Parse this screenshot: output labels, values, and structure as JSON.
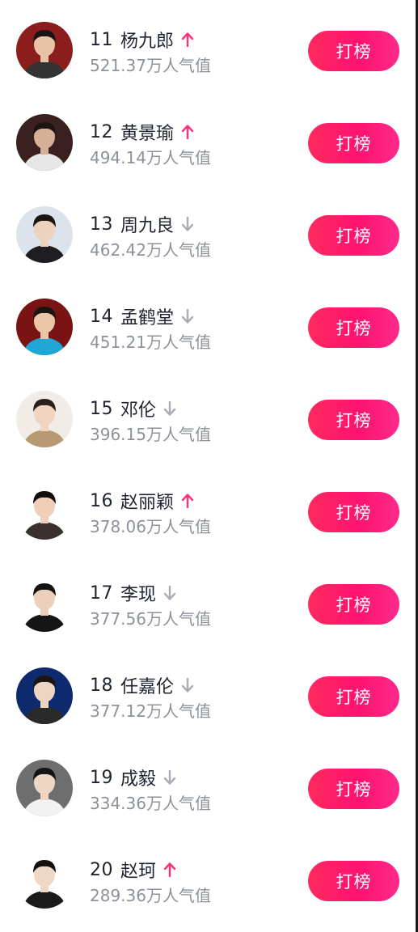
{
  "ranking": {
    "button_label": "打榜",
    "colors": {
      "up_arrow": "#ff2f7d",
      "down_arrow": "#a9acb6",
      "button_start": "#ff2a5f",
      "button_end": "#ff2a8a"
    },
    "entries": [
      {
        "rank": "11",
        "name": "杨九郎",
        "trend": "up",
        "score": "521.37万人气值",
        "avatar_bg": "#8c1d1d",
        "skin": "#e8c3a6",
        "hair": "#1a1412",
        "shirt": "#333333"
      },
      {
        "rank": "12",
        "name": "黄景瑜",
        "trend": "up",
        "score": "494.14万人气值",
        "avatar_bg": "#3a2020",
        "skin": "#d6b096",
        "hair": "#1a1412",
        "shirt": "#e6e6e6"
      },
      {
        "rank": "13",
        "name": "周九良",
        "trend": "down",
        "score": "462.42万人气值",
        "avatar_bg": "#dde3ec",
        "skin": "#edd2bd",
        "hair": "#1a1412",
        "shirt": "#1d1d22"
      },
      {
        "rank": "14",
        "name": "孟鹤堂",
        "trend": "down",
        "score": "451.21万人气值",
        "avatar_bg": "#7a1313",
        "skin": "#eac6a7",
        "hair": "#1a1412",
        "shirt": "#1fa7d8"
      },
      {
        "rank": "15",
        "name": "邓伦",
        "trend": "down",
        "score": "396.15万人气值",
        "avatar_bg": "#f2ece6",
        "skin": "#f0d4bf",
        "hair": "#2b2019",
        "shirt": "#b79a72"
      },
      {
        "rank": "16",
        "name": "赵丽颖",
        "trend": "up",
        "score": "378.06万人气值",
        "avatar_bg": "#ffffff",
        "skin": "#f0cfb9",
        "hair": "#120e0e",
        "shirt": "#3a3030"
      },
      {
        "rank": "17",
        "name": "李现",
        "trend": "down",
        "score": "377.56万人气值",
        "avatar_bg": "#ffffff",
        "skin": "#ecd0bc",
        "hair": "#151212",
        "shirt": "#151515"
      },
      {
        "rank": "18",
        "name": "任嘉伦",
        "trend": "down",
        "score": "377.12万人气值",
        "avatar_bg": "#0d2a6e",
        "skin": "#eed5c3",
        "hair": "#1c1612",
        "shirt": "#2a2a2a"
      },
      {
        "rank": "19",
        "name": "成毅",
        "trend": "down",
        "score": "334.36万人气值",
        "avatar_bg": "#6e6e6e",
        "skin": "#eed6c4",
        "hair": "#141414",
        "shirt": "#f2f2f2"
      },
      {
        "rank": "20",
        "name": "赵珂",
        "trend": "up",
        "score": "289.36万人气值",
        "avatar_bg": "#ffffff",
        "skin": "#f1d7c6",
        "hair": "#121212",
        "shirt": "#1a1a1a"
      }
    ]
  }
}
